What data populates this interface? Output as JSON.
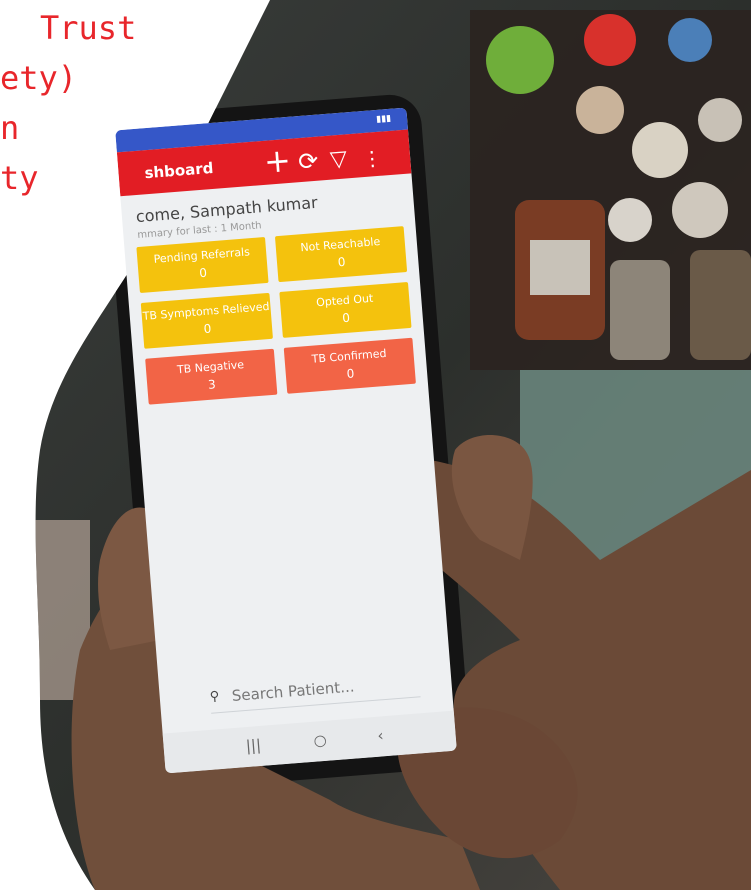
{
  "headline": {
    "lines": [
      "Trust",
      "ety)",
      "n",
      "ty"
    ],
    "color": "#e8262b"
  },
  "phone": {
    "app_bar": {
      "title": "shboard",
      "color": "#e21d24",
      "actions": {
        "add_icon": "plus-icon",
        "refresh_icon": "refresh-icon",
        "filter_icon": "filter-icon",
        "more_icon": "more-vertical-icon"
      }
    },
    "welcome_text": "come, Sampath kumar",
    "summary_text": "mmary for last : 1 Month",
    "tiles": [
      {
        "label": "Pending Referrals",
        "count": "0",
        "color": "#f4c20d"
      },
      {
        "label": "Not Reachable",
        "count": "0",
        "color": "#f4c20d"
      },
      {
        "label": "TB Symptoms Relieved",
        "count": "0",
        "color": "#f4c20d"
      },
      {
        "label": "Opted Out",
        "count": "0",
        "color": "#f4c20d"
      },
      {
        "label": "TB Negative",
        "count": "3",
        "color": "#f26446"
      },
      {
        "label": "TB Confirmed",
        "count": "0",
        "color": "#f26446"
      }
    ],
    "search_placeholder": "Search Patient...",
    "nav": {
      "recent": "|||",
      "home": "○",
      "back": "‹"
    }
  }
}
